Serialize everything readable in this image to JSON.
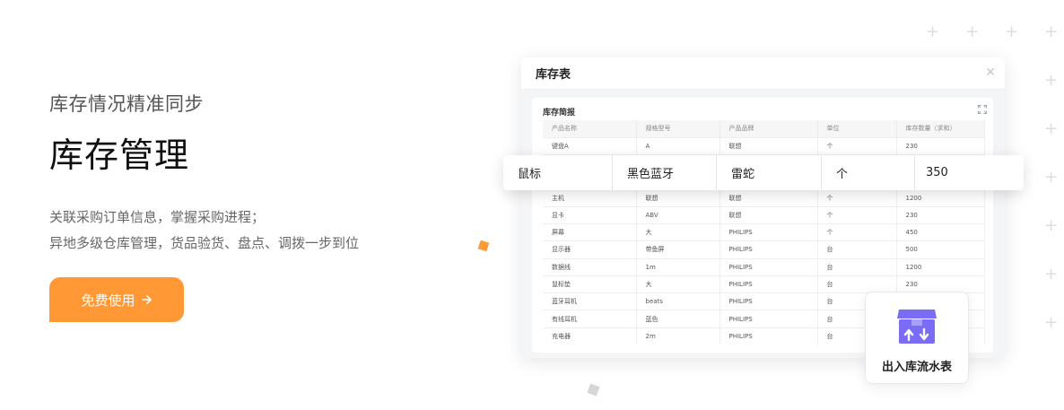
{
  "hero": {
    "subtitle": "库存情况精准同步",
    "title": "库存管理",
    "desc_line1": "关联采购订单信息，掌握采购进程；",
    "desc_line2": "异地多级仓库管理，货品验货、盘点、调拨一步到位",
    "cta_label": "免费使用",
    "cta_arrow_icon": "arrow-right-icon",
    "cta_color": "#ff9835"
  },
  "panel": {
    "title": "库存表",
    "close_icon": "close-icon",
    "card_title": "库存简报",
    "expand_icon": "expand-icon"
  },
  "table": {
    "columns": [
      "产品名称",
      "规格型号",
      "产品品牌",
      "单位",
      "库存数量（求和）"
    ],
    "rows": [
      [
        "键盘A",
        "A",
        "联想",
        "个",
        "230"
      ],
      [
        "",
        "",
        "",
        "",
        ""
      ],
      [
        "",
        "",
        "",
        "",
        ""
      ],
      [
        "主机",
        "联想",
        "联想",
        "个",
        "1200"
      ],
      [
        "显卡",
        "ABV",
        "联想",
        "个",
        "230"
      ],
      [
        "屏幕",
        "大",
        "PHILIPS",
        "个",
        "450"
      ],
      [
        "显示器",
        "带鱼屏",
        "PHILIPS",
        "台",
        "500"
      ],
      [
        "数据线",
        "1m",
        "PHILIPS",
        "台",
        "1200"
      ],
      [
        "鼠标垫",
        "大",
        "PHILIPS",
        "台",
        "230"
      ],
      [
        "蓝牙耳机",
        "beats",
        "PHILIPS",
        "台",
        ""
      ],
      [
        "有线耳机",
        "蓝色",
        "PHILIPS",
        "台",
        ""
      ],
      [
        "充电器",
        "2m",
        "PHILIPS",
        "台",
        ""
      ]
    ]
  },
  "highlight_row": {
    "cells": [
      "鼠标",
      "黑色蓝牙",
      "雷蛇",
      "个",
      "350"
    ]
  },
  "flow_card": {
    "label": "出入库流水表",
    "icon": "box-transfer-icon",
    "icon_color": "#7b6cf6"
  }
}
